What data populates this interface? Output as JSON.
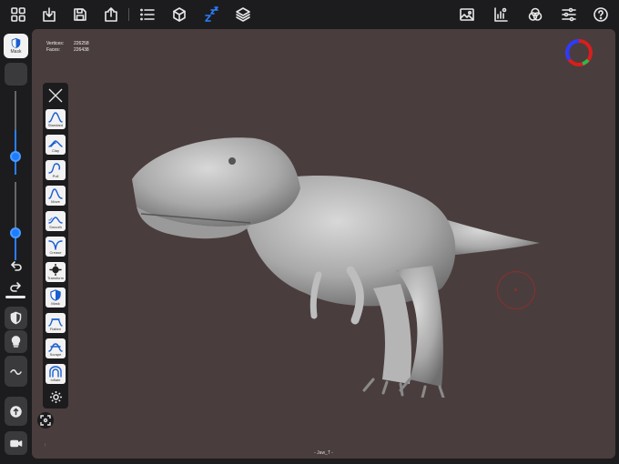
{
  "toolbar": {
    "left": [
      "grid-icon",
      "import-icon",
      "save-icon",
      "share-icon",
      "list-icon",
      "cube-icon",
      "sleep-icon",
      "layers-icon"
    ],
    "right": [
      "image-icon",
      "material-icon",
      "color-icon",
      "sliders-icon",
      "help-icon"
    ]
  },
  "sidebar": {
    "mask_label": "Mask",
    "slider_radius_level": 0.45,
    "slider_intensity_level": 0.35
  },
  "viewport": {
    "stats": {
      "vertices_label": "Vertices:",
      "vertices_value": "226258",
      "faces_label": "Faces:",
      "faces_value": "226438"
    },
    "object_name": "- Jaw_T -",
    "corner_mark": "↑",
    "background_color": "#4a3d3d"
  },
  "tools": [
    {
      "label": "Standard",
      "icon": "standard-brush-icon"
    },
    {
      "label": "Clay",
      "icon": "clay-brush-icon"
    },
    {
      "label": "Pull",
      "icon": "pull-brush-icon"
    },
    {
      "label": "Move",
      "icon": "move-brush-icon"
    },
    {
      "label": "Smooth",
      "icon": "smooth-brush-icon"
    },
    {
      "label": "Crease",
      "icon": "crease-brush-icon"
    },
    {
      "label": "Transform",
      "icon": "transform-icon"
    },
    {
      "label": "Mask",
      "icon": "mask-icon"
    },
    {
      "label": "Flatten",
      "icon": "flatten-brush-icon"
    },
    {
      "label": "Scrape",
      "icon": "scrape-brush-icon"
    },
    {
      "label": "Inflate",
      "icon": "inflate-brush-icon"
    }
  ],
  "colors": {
    "accent": "#1e7cff",
    "tool_icon": "#1a5fd0",
    "brush_cursor": "#8a3030"
  }
}
